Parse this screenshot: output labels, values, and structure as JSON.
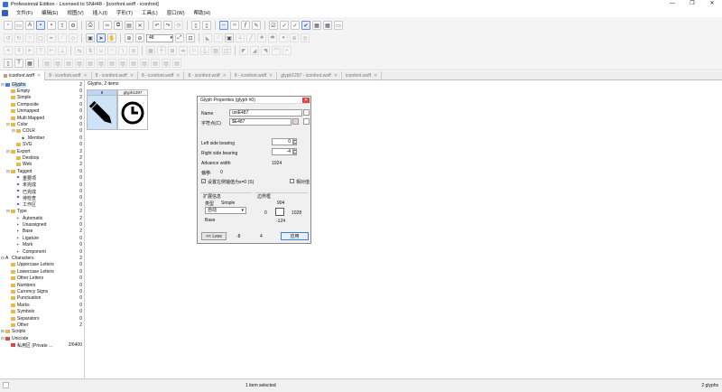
{
  "window": {
    "title": "Professional Edition - Licensed to SNH48 - [iconfont.woff - iconfont]",
    "controls": [
      "—",
      "❐",
      "✕"
    ]
  },
  "menu": [
    "文件(F)",
    "编辑(E)",
    "视图(V)",
    "插入(I)",
    "字形(T)",
    "工具(L)",
    "窗口(W)",
    "帮助(H)"
  ],
  "toolbar": {
    "zoom_value": "48"
  },
  "tabs": [
    {
      "label": "iconfont.woff",
      "active": true
    },
    {
      "label": "8 - iconfont.woff",
      "active": false
    },
    {
      "label": "8 - iconfont.woff",
      "active": false
    },
    {
      "label": "8 - iconfont.woff",
      "active": false
    },
    {
      "label": "8 - iconfont.woff",
      "active": false
    },
    {
      "label": "8 - iconfont.woff",
      "active": false
    },
    {
      "label": "glyph1297 - iconfont.woff",
      "active": false
    },
    {
      "label": "iconfont.woff",
      "active": false
    }
  ],
  "tree": [
    {
      "label": "Glyphs",
      "count": "2",
      "level": 0,
      "exp": "⊟",
      "icon": "glyphs",
      "sel": true
    },
    {
      "label": "Empty",
      "count": "0",
      "level": 1,
      "icon": "folder"
    },
    {
      "label": "Simple",
      "count": "2",
      "level": 1,
      "icon": "folder"
    },
    {
      "label": "Composite",
      "count": "0",
      "level": 1,
      "icon": "folder"
    },
    {
      "label": "Unmapped",
      "count": "0",
      "level": 1,
      "icon": "folder"
    },
    {
      "label": "Multi Mapped",
      "count": "0",
      "level": 1,
      "icon": "folder"
    },
    {
      "label": "Color",
      "count": "0",
      "level": 1,
      "exp": "⊟",
      "icon": "folder"
    },
    {
      "label": "COLR",
      "count": "0",
      "level": 2,
      "exp": "⊟",
      "icon": "folder"
    },
    {
      "label": "Member",
      "count": "0",
      "level": 3,
      "icon": "dot"
    },
    {
      "label": "SVG",
      "count": "0",
      "level": 2,
      "icon": "folder"
    },
    {
      "label": "Export",
      "count": "2",
      "level": 1,
      "exp": "⊟",
      "icon": "folder"
    },
    {
      "label": "Desktop",
      "count": "2",
      "level": 2,
      "icon": "folder"
    },
    {
      "label": "Web",
      "count": "2",
      "level": 2,
      "icon": "folder"
    },
    {
      "label": "Tagged",
      "count": "0",
      "level": 1,
      "exp": "⊟",
      "icon": "folder"
    },
    {
      "label": "重要项",
      "count": "0",
      "level": 2,
      "icon": "flag"
    },
    {
      "label": "未完成",
      "count": "0",
      "level": 2,
      "icon": "flag"
    },
    {
      "label": "已完成",
      "count": "0",
      "level": 2,
      "icon": "flag"
    },
    {
      "label": "待检查",
      "count": "0",
      "level": 2,
      "icon": "flag"
    },
    {
      "label": "工作区",
      "count": "0",
      "level": 2,
      "icon": "flag"
    },
    {
      "label": "Type",
      "count": "2",
      "level": 1,
      "exp": "⊟",
      "icon": "folder"
    },
    {
      "label": "Automatic",
      "count": "2",
      "level": 2,
      "icon": "glyph"
    },
    {
      "label": "Unassigned",
      "count": "0",
      "level": 2,
      "icon": "glyph"
    },
    {
      "label": "Base",
      "count": "2",
      "level": 2,
      "icon": "glyph"
    },
    {
      "label": "Ligature",
      "count": "0",
      "level": 2,
      "icon": "glyph"
    },
    {
      "label": "Mark",
      "count": "0",
      "level": 2,
      "icon": "glyph"
    },
    {
      "label": "Component",
      "count": "0",
      "level": 2,
      "icon": "glyph"
    },
    {
      "label": "Characters",
      "count": "2",
      "level": 0,
      "exp": "⊟",
      "icon": "chars"
    },
    {
      "label": "Uppercase Letters",
      "count": "0",
      "level": 1,
      "icon": "folder"
    },
    {
      "label": "Lowercase Letters",
      "count": "0",
      "level": 1,
      "icon": "folder"
    },
    {
      "label": "Other Letters",
      "count": "0",
      "level": 1,
      "icon": "folder"
    },
    {
      "label": "Numbers",
      "count": "0",
      "level": 1,
      "icon": "folder"
    },
    {
      "label": "Currency Signs",
      "count": "0",
      "level": 1,
      "icon": "folder"
    },
    {
      "label": "Punctuation",
      "count": "0",
      "level": 1,
      "icon": "folder"
    },
    {
      "label": "Marks",
      "count": "0",
      "level": 1,
      "icon": "folder"
    },
    {
      "label": "Symbols",
      "count": "0",
      "level": 1,
      "icon": "folder"
    },
    {
      "label": "Separators",
      "count": "0",
      "level": 1,
      "icon": "folder"
    },
    {
      "label": "Other",
      "count": "2",
      "level": 1,
      "icon": "folder"
    },
    {
      "label": "Scripts",
      "count": "",
      "level": 0,
      "exp": "⊞",
      "icon": "folder"
    },
    {
      "label": "Unicode",
      "count": "",
      "level": 0,
      "exp": "⊟",
      "icon": "unicode"
    },
    {
      "label": "私用区 (Private ...",
      "count": "2/6400",
      "level": 1,
      "icon": "unicode"
    }
  ],
  "content": {
    "header": "Glyphs, 2 items",
    "glyphs": [
      {
        "label": "8",
        "icon": "pencil-glyph"
      },
      {
        "label": "glyph1297",
        "icon": "clock-glyph"
      }
    ]
  },
  "dialog": {
    "title": "Glyph Properties (glyph #0)",
    "name_label": "Name",
    "name_value": "uniE487",
    "char_label": "字符点(C)",
    "char_value": "$E487",
    "lsb_label": "Left side bearing",
    "lsb_value": "0",
    "rsb_label": "Right side bearing",
    "rsb_value": "-4",
    "adv_label": "Advance width",
    "adv_value": "1024",
    "offset_label": "偏移:",
    "offset_value": "0",
    "check1_label": "设置左侧轴值为x=0 (S)",
    "check2_label": "相对值",
    "ext_group": "扩展信息",
    "type_label": "类型",
    "type_value": "Simple",
    "auto_value": "自动",
    "base_label": "Base",
    "bbox_group": "边界框",
    "bbox_top": "904",
    "bbox_left": "0",
    "bbox_right": "1028",
    "bbox_bottom": "-124",
    "less_label": "<< Less",
    "bottom_left_value": "-8",
    "bottom_mid_value": "4",
    "apply_label": "应用"
  },
  "status": {
    "center": "1 item selected",
    "right": "2 glyphs"
  }
}
